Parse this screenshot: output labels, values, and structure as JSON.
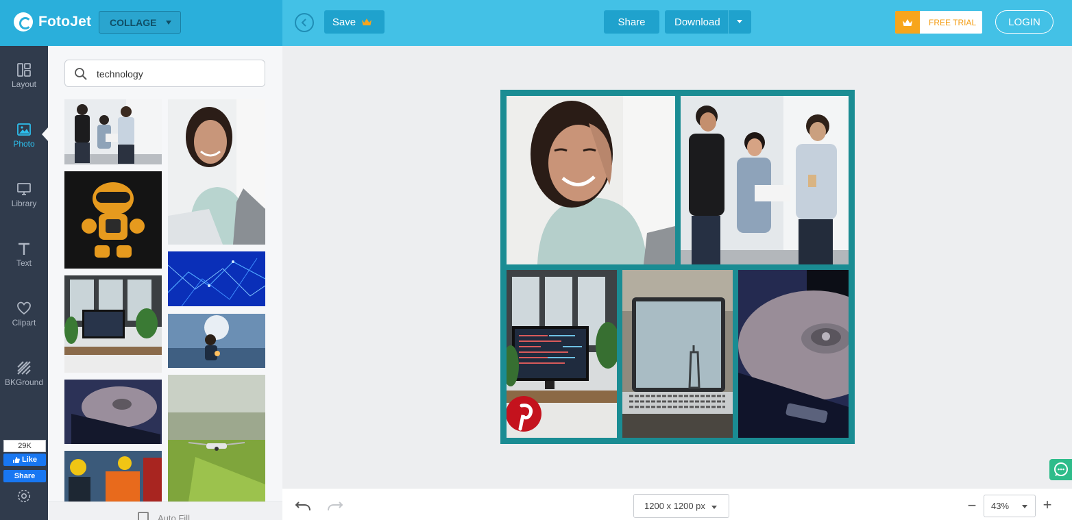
{
  "brand": {
    "name": "FotoJet"
  },
  "header": {
    "mode": "COLLAGE",
    "save_label": "Save",
    "share_label": "Share",
    "download_label": "Download",
    "free_trial_label": "FREE TRIAL",
    "login_label": "LOGIN"
  },
  "sidebar": {
    "items": [
      {
        "label": "Layout",
        "icon": "layout-icon"
      },
      {
        "label": "Photo",
        "icon": "photo-icon",
        "active": true
      },
      {
        "label": "Library",
        "icon": "library-icon"
      },
      {
        "label": "Text",
        "icon": "text-icon"
      },
      {
        "label": "Clipart",
        "icon": "heart-icon"
      },
      {
        "label": "BKGround",
        "icon": "background-icon"
      }
    ],
    "fb_count": "29K",
    "fb_like": "Like",
    "fb_share": "Share"
  },
  "photos": {
    "search_value": "technology",
    "items": [
      "three colleagues with tablet",
      "smiling woman at laptop",
      "orange robot",
      "blue polygon network",
      "office desk with computer",
      "person in lab",
      "hard drive",
      "drone over grass",
      "firefighters"
    ],
    "auto_fill_label": "Auto Fill"
  },
  "canvas": {
    "border_color": "#1a8c93",
    "cells": [
      "smiling woman",
      "colleagues with tablet",
      "desk with monitor",
      "laptop screen with bridge",
      "hard drive closeup"
    ]
  },
  "footer": {
    "canvas_size": "1200 x 1200 px",
    "zoom": "43%"
  },
  "colors": {
    "topbar": "#43c1e6",
    "brand_area": "#2aafdb",
    "nav": "#303b4c",
    "accent": "#2dc0ee",
    "trial": "#f7a51c"
  }
}
